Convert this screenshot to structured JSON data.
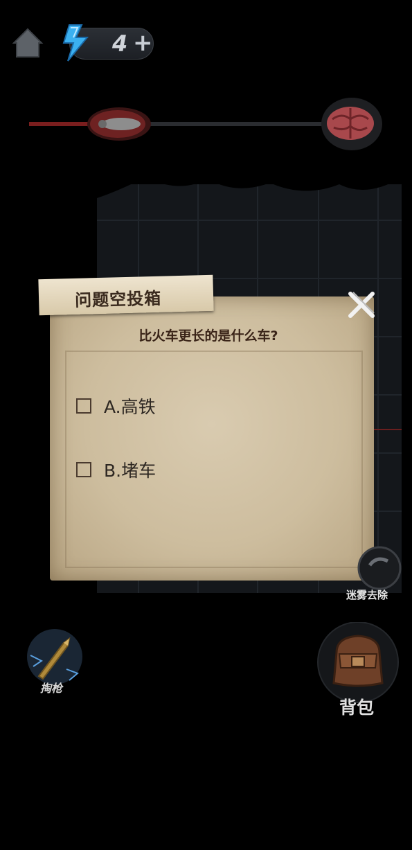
{
  "hud": {
    "home_icon": "home-icon",
    "energy_icon": "lightning-bolt-icon",
    "energy_count": "4",
    "energy_plus": "+"
  },
  "progress": {
    "start_icon": "bug-icon",
    "end_icon": "brain-icon",
    "accent_color": "#7a1e1e"
  },
  "modal": {
    "title": "问题空投箱",
    "close_icon": "close-x-icon",
    "question": "比火车更长的是什么车?",
    "options": [
      {
        "label": "A.高铁"
      },
      {
        "label": "B.堵车"
      }
    ]
  },
  "controls": {
    "clear_fog_label": "迷雾去除",
    "gun_label": "掏枪",
    "gun_icon": "bullet-icon",
    "bag_label": "背包",
    "bag_icon": "backpack-icon"
  }
}
